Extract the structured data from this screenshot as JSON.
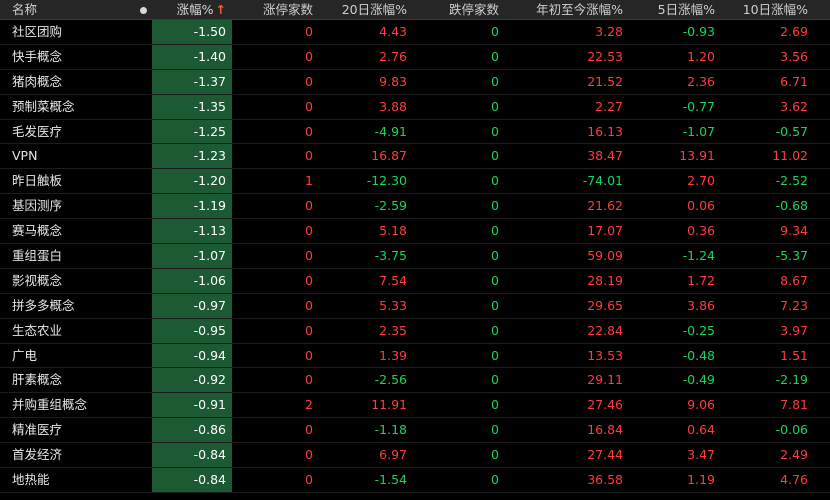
{
  "colors": {
    "up": "#ff3b3b",
    "down": "#19d35c",
    "highlight": "#1c5a34",
    "sort_arrow": "#ff5a2e"
  },
  "header": {
    "name": "名称",
    "chg": "涨幅%",
    "chg_sort_arrow": "↑",
    "up_count": "涨停家数",
    "chg_20d": "20日涨幅%",
    "down_count": "跌停家数",
    "ytd": "年初至今涨幅%",
    "chg_5d": "5日涨幅%",
    "chg_10d": "10日涨幅%"
  },
  "rows": [
    {
      "name": "社区团购",
      "chg": "-1.50",
      "up": "0",
      "d20": "4.43",
      "down": "0",
      "ytd": "3.28",
      "d5": "-0.93",
      "d10": "2.69"
    },
    {
      "name": "快手概念",
      "chg": "-1.40",
      "up": "0",
      "d20": "2.76",
      "down": "0",
      "ytd": "22.53",
      "d5": "1.20",
      "d10": "3.56"
    },
    {
      "name": "猪肉概念",
      "chg": "-1.37",
      "up": "0",
      "d20": "9.83",
      "down": "0",
      "ytd": "21.52",
      "d5": "2.36",
      "d10": "6.71"
    },
    {
      "name": "预制菜概念",
      "chg": "-1.35",
      "up": "0",
      "d20": "3.88",
      "down": "0",
      "ytd": "2.27",
      "d5": "-0.77",
      "d10": "3.62"
    },
    {
      "name": "毛发医疗",
      "chg": "-1.25",
      "up": "0",
      "d20": "-4.91",
      "down": "0",
      "ytd": "16.13",
      "d5": "-1.07",
      "d10": "-0.57"
    },
    {
      "name": "VPN",
      "chg": "-1.23",
      "up": "0",
      "d20": "16.87",
      "down": "0",
      "ytd": "38.47",
      "d5": "13.91",
      "d10": "11.02"
    },
    {
      "name": "昨日触板",
      "chg": "-1.20",
      "up": "1",
      "d20": "-12.30",
      "down": "0",
      "ytd": "-74.01",
      "d5": "2.70",
      "d10": "-2.52"
    },
    {
      "name": "基因测序",
      "chg": "-1.19",
      "up": "0",
      "d20": "-2.59",
      "down": "0",
      "ytd": "21.62",
      "d5": "0.06",
      "d10": "-0.68"
    },
    {
      "name": "赛马概念",
      "chg": "-1.13",
      "up": "0",
      "d20": "5.18",
      "down": "0",
      "ytd": "17.07",
      "d5": "0.36",
      "d10": "9.34"
    },
    {
      "name": "重组蛋白",
      "chg": "-1.07",
      "up": "0",
      "d20": "-3.75",
      "down": "0",
      "ytd": "59.09",
      "d5": "-1.24",
      "d10": "-5.37"
    },
    {
      "name": "影视概念",
      "chg": "-1.06",
      "up": "0",
      "d20": "7.54",
      "down": "0",
      "ytd": "28.19",
      "d5": "1.72",
      "d10": "8.67"
    },
    {
      "name": "拼多多概念",
      "chg": "-0.97",
      "up": "0",
      "d20": "5.33",
      "down": "0",
      "ytd": "29.65",
      "d5": "3.86",
      "d10": "7.23"
    },
    {
      "name": "生态农业",
      "chg": "-0.95",
      "up": "0",
      "d20": "2.35",
      "down": "0",
      "ytd": "22.84",
      "d5": "-0.25",
      "d10": "3.97"
    },
    {
      "name": "广电",
      "chg": "-0.94",
      "up": "0",
      "d20": "1.39",
      "down": "0",
      "ytd": "13.53",
      "d5": "-0.48",
      "d10": "1.51"
    },
    {
      "name": "肝素概念",
      "chg": "-0.92",
      "up": "0",
      "d20": "-2.56",
      "down": "0",
      "ytd": "29.11",
      "d5": "-0.49",
      "d10": "-2.19"
    },
    {
      "name": "并购重组概念",
      "chg": "-0.91",
      "up": "2",
      "d20": "11.91",
      "down": "0",
      "ytd": "27.46",
      "d5": "9.06",
      "d10": "7.81"
    },
    {
      "name": "精准医疗",
      "chg": "-0.86",
      "up": "0",
      "d20": "-1.18",
      "down": "0",
      "ytd": "16.84",
      "d5": "0.64",
      "d10": "-0.06"
    },
    {
      "name": "首发经济",
      "chg": "-0.84",
      "up": "0",
      "d20": "6.97",
      "down": "0",
      "ytd": "27.44",
      "d5": "3.47",
      "d10": "2.49"
    },
    {
      "name": "地热能",
      "chg": "-0.84",
      "up": "0",
      "d20": "-1.54",
      "down": "0",
      "ytd": "36.58",
      "d5": "1.19",
      "d10": "4.76"
    }
  ]
}
